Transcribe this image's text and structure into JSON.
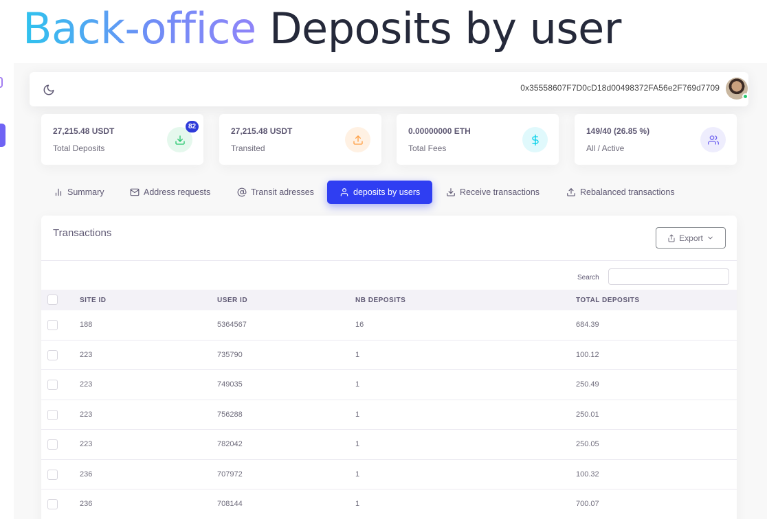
{
  "hero": {
    "accent": "Back-office",
    "title": "Deposits by user"
  },
  "navbar": {
    "theme_icon": "moon-icon",
    "wallet_address": "0x35558607F7D0cD18d00498372FA56e2F769d7709"
  },
  "stats": [
    {
      "value": "27,215.48 USDT",
      "label": "Total Deposits",
      "icon": "download-icon",
      "badge": "82",
      "color": "#28c76f"
    },
    {
      "value": "27,215.48 USDT",
      "label": "Transited",
      "icon": "upload-icon",
      "color": "#ff9f43"
    },
    {
      "value": "0.00000000 ETH",
      "label": "Total Fees",
      "icon": "dollar-icon",
      "color": "#00cfe8"
    },
    {
      "value": "149/40 (26.85 %)",
      "label": "All / Active",
      "icon": "users-icon",
      "color": "#7367f0"
    }
  ],
  "tabs": [
    {
      "label": "Summary",
      "icon": "bar-chart-icon"
    },
    {
      "label": "Address requests",
      "icon": "mail-icon"
    },
    {
      "label": "Transit adresses",
      "icon": "at-icon"
    },
    {
      "label": "deposits by users",
      "icon": "user-icon",
      "active": true
    },
    {
      "label": "Receive transactions",
      "icon": "download-icon"
    },
    {
      "label": "Rebalanced transactions",
      "icon": "upload-icon"
    }
  ],
  "card": {
    "title": "Transactions",
    "export_label": "Export",
    "search_label": "Search",
    "columns": [
      "SITE ID",
      "USER ID",
      "NB DEPOSITS",
      "TOTAL DEPOSITS"
    ],
    "rows": [
      [
        "188",
        "5364567",
        "16",
        "684.39"
      ],
      [
        "223",
        "735790",
        "1",
        "100.12"
      ],
      [
        "223",
        "749035",
        "1",
        "250.49"
      ],
      [
        "223",
        "756288",
        "1",
        "250.01"
      ],
      [
        "223",
        "782042",
        "1",
        "250.05"
      ],
      [
        "236",
        "707972",
        "1",
        "100.32"
      ],
      [
        "236",
        "708144",
        "1",
        "700.07"
      ]
    ]
  },
  "colors": {
    "primary": "#2f3ef2",
    "accent_gradient_start": "#2fc3ee",
    "accent_gradient_end": "#8f84f8"
  }
}
